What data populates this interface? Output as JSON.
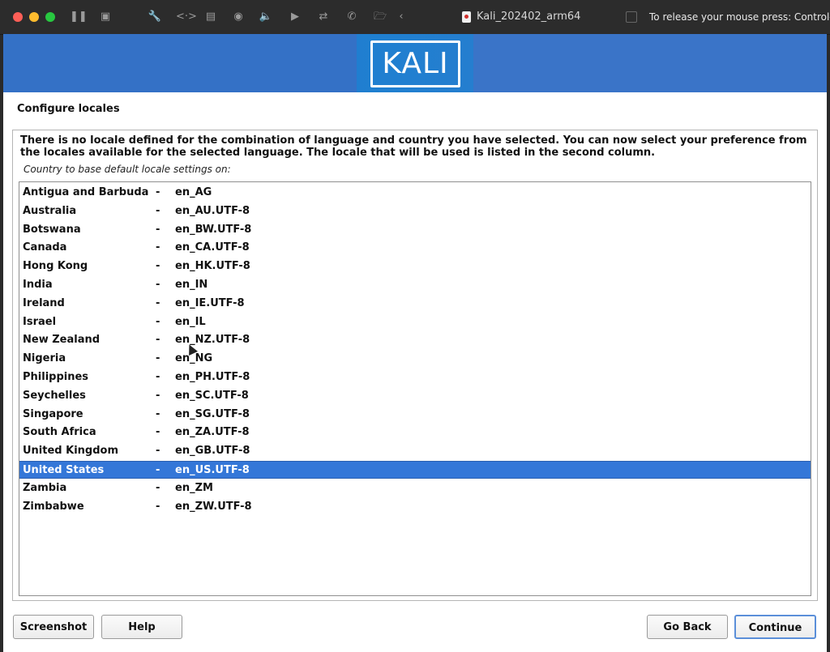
{
  "titlebar": {
    "vm_name": "Kali_202402_arm64",
    "release_hint": "To release your mouse press: Control-⌘"
  },
  "banner": {
    "logo_text": "KALI"
  },
  "page_title": "Configure locales",
  "description": "There is no locale defined for the combination of language and country you have selected. You can now select your preference from the locales available for the selected language. The locale that will be used is listed in the second column.",
  "question": "Country to base default locale settings on:",
  "locales": [
    {
      "country": "Antigua and Barbuda",
      "locale": "en_AG"
    },
    {
      "country": "Australia",
      "locale": "en_AU.UTF-8"
    },
    {
      "country": "Botswana",
      "locale": "en_BW.UTF-8"
    },
    {
      "country": "Canada",
      "locale": "en_CA.UTF-8"
    },
    {
      "country": "Hong Kong",
      "locale": "en_HK.UTF-8"
    },
    {
      "country": "India",
      "locale": "en_IN"
    },
    {
      "country": "Ireland",
      "locale": "en_IE.UTF-8"
    },
    {
      "country": "Israel",
      "locale": "en_IL"
    },
    {
      "country": "New Zealand",
      "locale": "en_NZ.UTF-8"
    },
    {
      "country": "Nigeria",
      "locale": "en_NG"
    },
    {
      "country": "Philippines",
      "locale": "en_PH.UTF-8"
    },
    {
      "country": "Seychelles",
      "locale": "en_SC.UTF-8"
    },
    {
      "country": "Singapore",
      "locale": "en_SG.UTF-8"
    },
    {
      "country": "South Africa",
      "locale": "en_ZA.UTF-8"
    },
    {
      "country": "United Kingdom",
      "locale": "en_GB.UTF-8"
    },
    {
      "country": "United States",
      "locale": "en_US.UTF-8"
    },
    {
      "country": "Zambia",
      "locale": "en_ZM"
    },
    {
      "country": "Zimbabwe",
      "locale": "en_ZW.UTF-8"
    }
  ],
  "selected_country": "United States",
  "separator": "-",
  "buttons": {
    "screenshot": "Screenshot",
    "help": "Help",
    "go_back": "Go Back",
    "continue": "Continue"
  },
  "colors": {
    "selection": "#3477d8",
    "banner": "#2f6fc4"
  }
}
